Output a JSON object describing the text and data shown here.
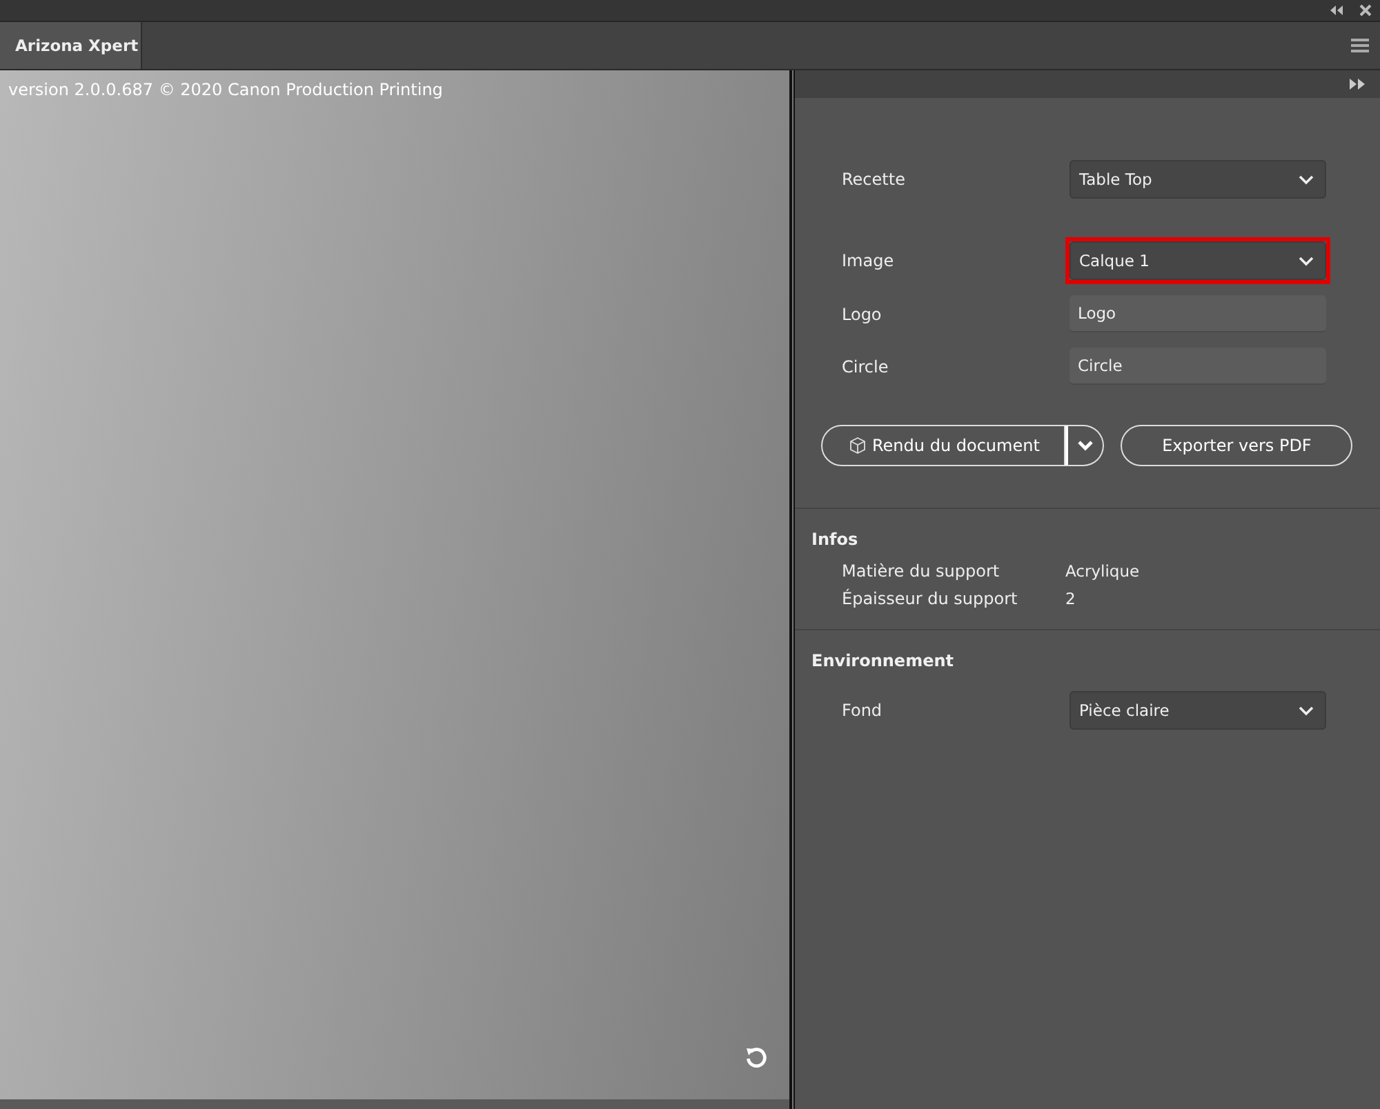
{
  "window": {
    "tab": "Arizona Xpert"
  },
  "viewer": {
    "version": "version 2.0.0.687 © 2020 Canon Production Printing"
  },
  "fields": [
    {
      "kind": "select",
      "label": "Recette",
      "value": "Table Top",
      "highlighted": false
    },
    {
      "kind": "select",
      "label": "Image",
      "value": "Calque 1",
      "highlighted": true
    },
    {
      "kind": "text",
      "label": "Logo",
      "value": "Logo",
      "highlighted": false
    },
    {
      "kind": "text",
      "label": "Circle",
      "value": "Circle",
      "highlighted": false
    }
  ],
  "actions": {
    "render": "Rendu du document",
    "export": "Exporter vers PDF"
  },
  "infos": {
    "title": "Infos",
    "rows": [
      {
        "label": "Matière du support",
        "value": "Acrylique"
      },
      {
        "label": "Épaisseur du support",
        "value": "2"
      }
    ]
  },
  "environment": {
    "title": "Environnement",
    "fields": [
      {
        "kind": "select",
        "label": "Fond",
        "value": "Pièce claire",
        "highlighted": false
      }
    ]
  }
}
